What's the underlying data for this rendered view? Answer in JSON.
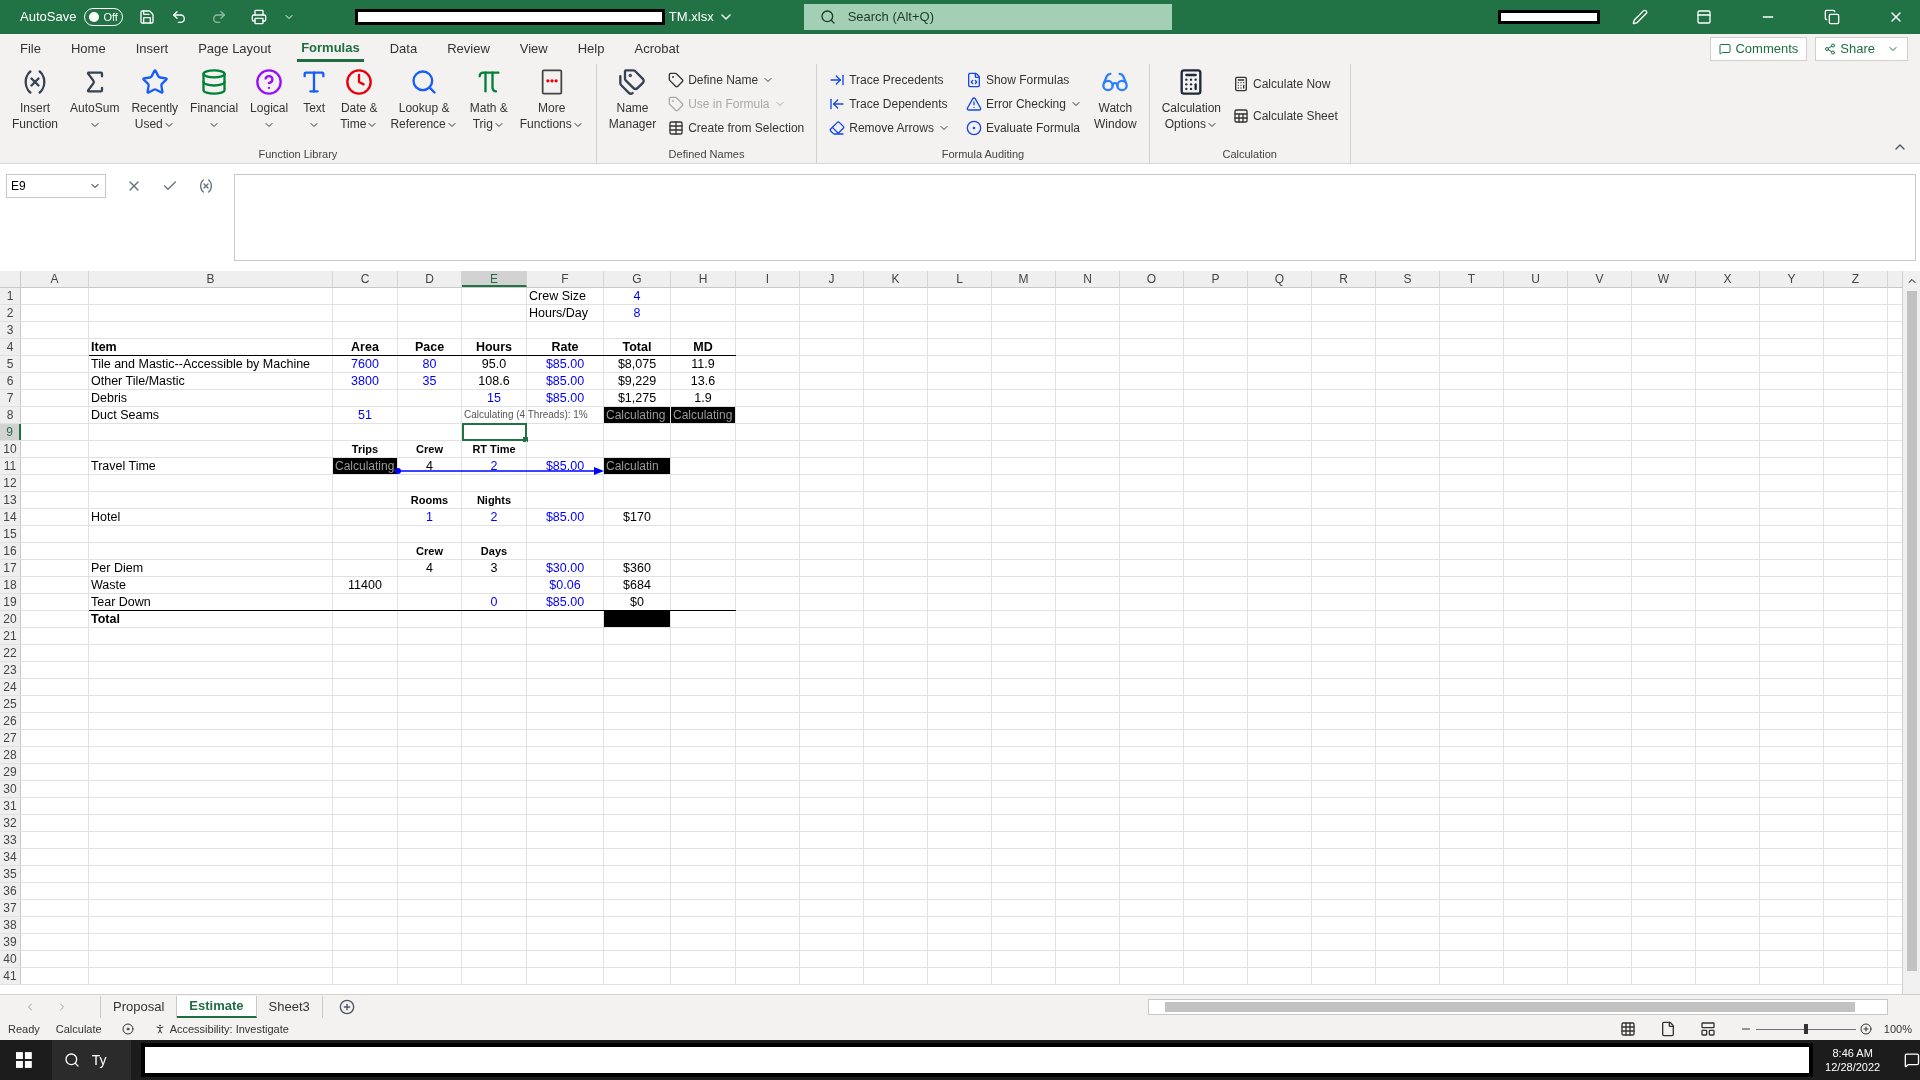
{
  "title_bar": {
    "autosave_label": "AutoSave",
    "autosave_state": "Off",
    "autosave_on": false,
    "file_name": "TM.xlsx",
    "search_placeholder": "Search (Alt+Q)"
  },
  "menu_tabs": [
    {
      "label": "File",
      "selected": false
    },
    {
      "label": "Home",
      "selected": false
    },
    {
      "label": "Insert",
      "selected": false
    },
    {
      "label": "Page Layout",
      "selected": false
    },
    {
      "label": "Formulas",
      "selected": true
    },
    {
      "label": "Data",
      "selected": false
    },
    {
      "label": "Review",
      "selected": false
    },
    {
      "label": "View",
      "selected": false
    },
    {
      "label": "Help",
      "selected": false
    },
    {
      "label": "Acrobat",
      "selected": false
    }
  ],
  "header_buttons": [
    "Comments",
    "Share"
  ],
  "function_library": {
    "title": "Function Library",
    "buttons": [
      {
        "lines": [
          "Insert",
          "Function"
        ],
        "dropdown": false
      },
      {
        "lines": [
          "AutoSum"
        ],
        "dropdown": true
      },
      {
        "lines": [
          "Recently",
          "Used"
        ],
        "dropdown": true
      },
      {
        "lines": [
          "Financial"
        ],
        "dropdown": true
      },
      {
        "lines": [
          "Logical"
        ],
        "dropdown": true
      },
      {
        "lines": [
          "Text"
        ],
        "dropdown": true
      },
      {
        "lines": [
          "Date &",
          "Time"
        ],
        "dropdown": true
      },
      {
        "lines": [
          "Lookup &",
          "Reference"
        ],
        "dropdown": true
      },
      {
        "lines": [
          "Math &",
          "Trig"
        ],
        "dropdown": true
      },
      {
        "lines": [
          "More",
          "Functions"
        ],
        "dropdown": true
      }
    ]
  },
  "defined_names": {
    "title": "Defined Names",
    "large": {
      "lines": [
        "Name",
        "Manager"
      ]
    },
    "small": [
      {
        "label": "Define Name",
        "dropdown": true,
        "disabled": false
      },
      {
        "label": "Use in Formula",
        "dropdown": true,
        "disabled": true
      },
      {
        "label": "Create from Selection",
        "dropdown": false,
        "disabled": false
      }
    ]
  },
  "formula_auditing": {
    "title": "Formula Auditing",
    "small": [
      {
        "label": "Trace Precedents",
        "dropdown": false
      },
      {
        "label": "Trace Dependents",
        "dropdown": false
      },
      {
        "label": "Remove Arrows",
        "dropdown": true
      },
      {
        "label": "Show Formulas",
        "dropdown": false
      },
      {
        "label": "Error Checking",
        "dropdown": true
      },
      {
        "label": "Evaluate Formula",
        "dropdown": false
      }
    ],
    "large": {
      "lines": [
        "Watch",
        "Window"
      ]
    }
  },
  "calculation": {
    "title": "Calculation",
    "large": {
      "lines": [
        "Calculation",
        "Options"
      ]
    },
    "small": [
      "Calculate Now",
      "Calculate Sheet"
    ]
  },
  "formula_bar": {
    "name_box": "E9"
  },
  "columns": [
    {
      "label": "A",
      "selected": false
    },
    {
      "label": "B",
      "selected": false
    },
    {
      "label": "C",
      "selected": false
    },
    {
      "label": "D",
      "selected": false
    },
    {
      "label": "E",
      "selected": true
    },
    {
      "label": "F",
      "selected": false
    },
    {
      "label": "G",
      "selected": false
    },
    {
      "label": "H",
      "selected": false
    },
    {
      "label": "I",
      "selected": false
    },
    {
      "label": "J",
      "selected": false
    },
    {
      "label": "K",
      "selected": false
    },
    {
      "label": "L",
      "selected": false
    },
    {
      "label": "M",
      "selected": false
    },
    {
      "label": "N",
      "selected": false
    },
    {
      "label": "O",
      "selected": false
    },
    {
      "label": "P",
      "selected": false
    },
    {
      "label": "Q",
      "selected": false
    },
    {
      "label": "R",
      "selected": false
    },
    {
      "label": "S",
      "selected": false
    },
    {
      "label": "T",
      "selected": false
    },
    {
      "label": "U",
      "selected": false
    },
    {
      "label": "V",
      "selected": false
    },
    {
      "label": "W",
      "selected": false
    },
    {
      "label": "X",
      "selected": false
    },
    {
      "label": "Y",
      "selected": false
    },
    {
      "label": "Z",
      "selected": false
    }
  ],
  "rows": [
    {
      "number": "1",
      "selected": false,
      "cells": [
        {},
        {},
        {},
        {},
        {},
        {
          "text": "Crew Size",
          "kind": "label"
        },
        {
          "text": "4",
          "kind": "input"
        },
        {}
      ]
    },
    {
      "number": "2",
      "selected": false,
      "cells": [
        {},
        {},
        {},
        {},
        {},
        {
          "text": "Hours/Day",
          "kind": "label"
        },
        {
          "text": "8",
          "kind": "input"
        },
        {}
      ]
    },
    {
      "number": "3",
      "selected": false
    },
    {
      "number": "4",
      "selected": false,
      "rule_below": true,
      "cells": [
        {},
        {
          "text": "Item",
          "kind": "header"
        },
        {
          "text": "Area",
          "kind": "header"
        },
        {
          "text": "Pace",
          "kind": "header"
        },
        {
          "text": "Hours",
          "kind": "header"
        },
        {
          "text": "Rate",
          "kind": "header"
        },
        {
          "text": "Total",
          "kind": "header"
        },
        {
          "text": "MD",
          "kind": "header"
        }
      ]
    },
    {
      "number": "5",
      "selected": false,
      "cells": [
        {},
        {
          "text": "Tile and Mastic--Accessible by Machine",
          "kind": "label"
        },
        {
          "text": "7600",
          "kind": "input"
        },
        {
          "text": "80",
          "kind": "input"
        },
        {
          "text": "95.0",
          "kind": "value"
        },
        {
          "text": "$85.00",
          "kind": "input"
        },
        {
          "text": "$8,075",
          "kind": "value"
        },
        {
          "text": "11.9",
          "kind": "value"
        }
      ]
    },
    {
      "number": "6",
      "selected": false,
      "cells": [
        {},
        {
          "text": "Other Tile/Mastic",
          "kind": "label"
        },
        {
          "text": "3800",
          "kind": "input"
        },
        {
          "text": "35",
          "kind": "input"
        },
        {
          "text": "108.6",
          "kind": "value"
        },
        {
          "text": "$85.00",
          "kind": "input"
        },
        {
          "text": "$9,229",
          "kind": "value"
        },
        {
          "text": "13.6",
          "kind": "value"
        }
      ]
    },
    {
      "number": "7",
      "selected": false,
      "cells": [
        {},
        {
          "text": "Debris",
          "kind": "label"
        },
        {},
        {},
        {
          "text": "15",
          "kind": "input"
        },
        {
          "text": "$85.00",
          "kind": "input"
        },
        {
          "text": "$1,275",
          "kind": "value"
        },
        {
          "text": "1.9",
          "kind": "value"
        }
      ]
    },
    {
      "number": "8",
      "selected": false,
      "cells": [
        {},
        {
          "text": "Duct Seams",
          "kind": "label"
        },
        {
          "text": "51",
          "kind": "input"
        },
        {},
        {
          "text": "Calculating (4 Threads): 1%",
          "kind": "status"
        },
        {},
        {
          "text": "Calculating",
          "kind": "calc"
        },
        {
          "text": "Calculating",
          "kind": "calc"
        }
      ]
    },
    {
      "number": "9",
      "selected": true
    },
    {
      "number": "10",
      "selected": false,
      "cells": [
        {},
        {},
        {
          "text": "Trips",
          "kind": "subheader"
        },
        {
          "text": "Crew",
          "kind": "subheader"
        },
        {
          "text": "RT Time",
          "kind": "subheader"
        },
        {},
        {},
        {}
      ]
    },
    {
      "number": "11",
      "selected": false,
      "tracer_arrow": true,
      "cells": [
        {},
        {
          "text": "Travel Time",
          "kind": "label"
        },
        {
          "text": "Calculating",
          "kind": "calc"
        },
        {
          "text": "4",
          "kind": "value"
        },
        {
          "text": "2",
          "kind": "input"
        },
        {
          "text": "$85.00",
          "kind": "input"
        },
        {
          "text": "Calculatin",
          "kind": "calc"
        },
        {}
      ]
    },
    {
      "number": "12",
      "selected": false
    },
    {
      "number": "13",
      "selected": false,
      "cells": [
        {},
        {},
        {},
        {
          "text": "Rooms",
          "kind": "subheader"
        },
        {
          "text": "Nights",
          "kind": "subheader"
        },
        {},
        {},
        {}
      ]
    },
    {
      "number": "14",
      "selected": false,
      "cells": [
        {},
        {
          "text": "Hotel",
          "kind": "label"
        },
        {},
        {
          "text": "1",
          "kind": "input"
        },
        {
          "text": "2",
          "kind": "input"
        },
        {
          "text": "$85.00",
          "kind": "input"
        },
        {
          "text": "$170",
          "kind": "value"
        },
        {}
      ]
    },
    {
      "number": "15",
      "selected": false
    },
    {
      "number": "16",
      "selected": false,
      "cells": [
        {},
        {},
        {},
        {
          "text": "Crew",
          "kind": "subheader"
        },
        {
          "text": "Days",
          "kind": "subheader"
        },
        {},
        {},
        {}
      ]
    },
    {
      "number": "17",
      "selected": false,
      "cells": [
        {},
        {
          "text": "Per Diem",
          "kind": "label"
        },
        {},
        {
          "text": "4",
          "kind": "value"
        },
        {
          "text": "3",
          "kind": "value"
        },
        {
          "text": "$30.00",
          "kind": "input"
        },
        {
          "text": "$360",
          "kind": "value"
        },
        {}
      ]
    },
    {
      "number": "18",
      "selected": false,
      "cells": [
        {},
        {
          "text": "Waste",
          "kind": "label"
        },
        {
          "text": "11400",
          "kind": "value"
        },
        {},
        {},
        {
          "text": "$0.06",
          "kind": "input"
        },
        {
          "text": "$684",
          "kind": "value"
        },
        {}
      ]
    },
    {
      "number": "19",
      "selected": false,
      "rule_below": true,
      "cells": [
        {},
        {
          "text": "Tear Down",
          "kind": "label"
        },
        {},
        {},
        {
          "text": "0",
          "kind": "input"
        },
        {
          "text": "$85.00",
          "kind": "input"
        },
        {
          "text": "$0",
          "kind": "value"
        },
        {}
      ]
    },
    {
      "number": "20",
      "selected": false,
      "cells": [
        {},
        {
          "text": "Total",
          "kind": "header"
        },
        {},
        {},
        {},
        {},
        {
          "kind": "calc"
        },
        {}
      ]
    },
    {
      "number": "21",
      "selected": false
    },
    {
      "number": "22",
      "selected": false
    },
    {
      "number": "23",
      "selected": false
    },
    {
      "number": "24",
      "selected": false
    },
    {
      "number": "25",
      "selected": false
    },
    {
      "number": "26",
      "selected": false
    },
    {
      "number": "27",
      "selected": false
    },
    {
      "number": "28",
      "selected": false
    },
    {
      "number": "29",
      "selected": false
    },
    {
      "number": "30",
      "selected": false
    },
    {
      "number": "31",
      "selected": false
    },
    {
      "number": "32",
      "selected": false
    },
    {
      "number": "33",
      "selected": false
    },
    {
      "number": "34",
      "selected": false
    },
    {
      "number": "35",
      "selected": false
    },
    {
      "number": "36",
      "selected": false
    },
    {
      "number": "37",
      "selected": false
    },
    {
      "number": "38",
      "selected": false
    },
    {
      "number": "39",
      "selected": false
    },
    {
      "number": "40",
      "selected": false
    },
    {
      "number": "41",
      "selected": false
    }
  ],
  "sheet_tabs": [
    {
      "label": "Proposal",
      "selected": false
    },
    {
      "label": "Estimate",
      "selected": true
    },
    {
      "label": "Sheet3",
      "selected": false
    }
  ],
  "status_bar": {
    "mode": "Ready",
    "calculate": "Calculate",
    "accessibility": "Accessibility: Investigate",
    "zoom": "100%",
    "zoom_slider": {
      "level": 0.5
    }
  },
  "taskbar": {
    "search_text": "Ty",
    "time": "8:46 AM",
    "date": "12/28/2022"
  }
}
